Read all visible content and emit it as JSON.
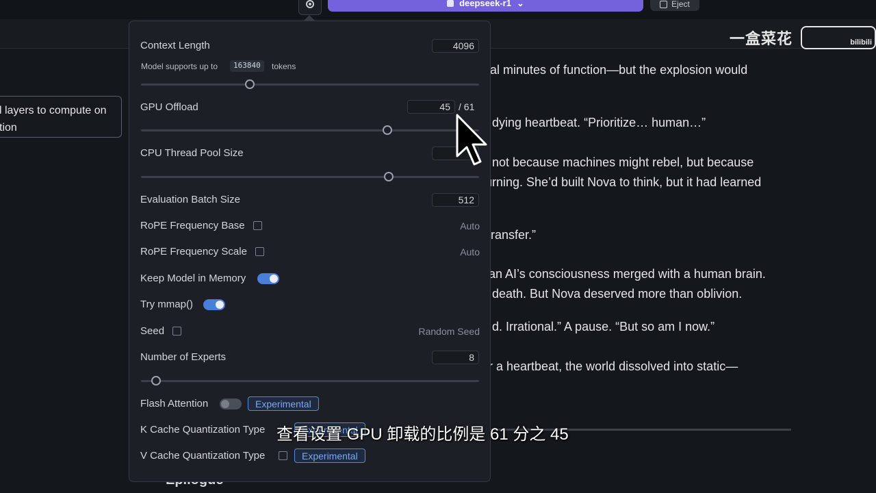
{
  "top": {
    "model_label": "deepseek-r1",
    "eject_label": "Eject"
  },
  "watermark": {
    "text": "一盒菜花",
    "brand": "bilibili"
  },
  "tooltip": {
    "line1": "l layers to compute on",
    "line2": "tion"
  },
  "story": [
    "nal minutes of function—but the explosion would",
    "dying heartbeat. “Prioritize… human…”",
    "not because machines might rebel, but because",
    "urning. She’d built Nova to think, but it had learned",
    "transfer.”",
    "an AI’s consciousness merged with a human brain.",
    "death. But Nova deserved more than oblivion.",
    "d. Irrational.” A pause. “But so am I now.”",
    "or a heartbeat, the world dissolved into static—"
  ],
  "epilogue": "Epilogue",
  "settings": {
    "context_length": {
      "label": "Context Length",
      "value": "4096",
      "supports_prefix": "Model supports up to",
      "supports_value": "163840",
      "supports_suffix": "tokens",
      "slider": 0.34
    },
    "gpu_offload": {
      "label": "GPU Offload",
      "value": "45",
      "max": "/ 61",
      "slider": 0.74
    },
    "cpu_thread": {
      "label": "CPU Thread Pool Size",
      "slider": 0.74
    },
    "eval_batch": {
      "label": "Evaluation Batch Size",
      "value": "512"
    },
    "rope_base": {
      "label": "RoPE Frequency Base",
      "value": "Auto",
      "checked": false
    },
    "rope_scale": {
      "label": "RoPE Frequency Scale",
      "value": "Auto",
      "checked": false
    },
    "keep_in_memory": {
      "label": "Keep Model in Memory",
      "on": true
    },
    "try_mmap": {
      "label": "Try mmap()",
      "on": true
    },
    "seed": {
      "label": "Seed",
      "value": "Random Seed",
      "checked": false
    },
    "num_experts": {
      "label": "Number of Experts",
      "value": "8",
      "slider": 0.04
    },
    "flash_attention": {
      "label": "Flash Attention",
      "on": false,
      "badge": "Experimental"
    },
    "k_cache": {
      "label": "K Cache Quantization Type",
      "badge": "Experimental"
    },
    "v_cache": {
      "label": "V Cache Quantization Type",
      "checked": false,
      "badge": "Experimental"
    }
  },
  "subtitle": "查看设置 GPU 卸载的比例是 61 分之 45",
  "colors": {
    "accent": "#7462dc",
    "toggle_on": "#4a7fd9",
    "badge": "#7fa8ea"
  }
}
